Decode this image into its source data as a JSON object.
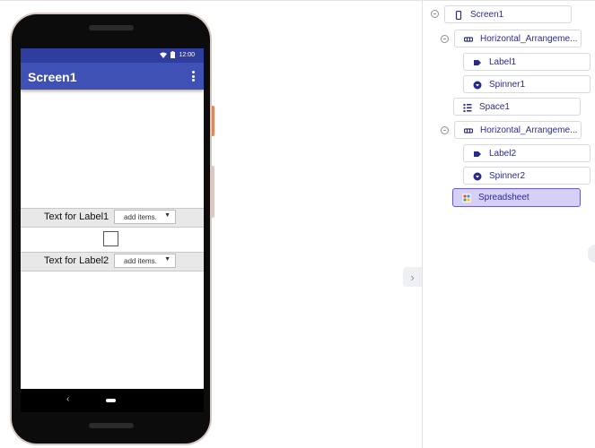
{
  "phone": {
    "status_time": "12:00",
    "screen_title": "Screen1",
    "arrangement1": {
      "label": "Text for Label1",
      "spinner_text": "add items.",
      "spinner_arrow": "▼"
    },
    "arrangement2": {
      "label": "Text for Label2",
      "spinner_text": "add items.",
      "spinner_arrow": "▼"
    },
    "nav_back": "‹"
  },
  "tree": {
    "items": [
      {
        "label": "Screen1",
        "icon": "phone-icon"
      },
      {
        "label": "Horizontal_Arrangeme...",
        "icon": "horizontal-arrangement-icon"
      },
      {
        "label": "Label1",
        "icon": "label-icon"
      },
      {
        "label": "Spinner1",
        "icon": "spinner-icon"
      },
      {
        "label": "Space1",
        "icon": "space-icon"
      },
      {
        "label": "Horizontal_Arrangeme...",
        "icon": "horizontal-arrangement-icon"
      },
      {
        "label": "Label2",
        "icon": "label-icon"
      },
      {
        "label": "Spinner2",
        "icon": "spinner-icon"
      },
      {
        "label": "Spreadsheet",
        "icon": "spreadsheet-icon",
        "selected": true
      }
    ]
  },
  "panel": {
    "collapse_glyph": "›"
  },
  "colors": {
    "app_bar": "#3f51b5",
    "status_bar": "#2f3e9e",
    "tree_text": "#2b2b8f",
    "selected_bg": "#d6d0f7",
    "selected_border": "#6a5acd"
  }
}
